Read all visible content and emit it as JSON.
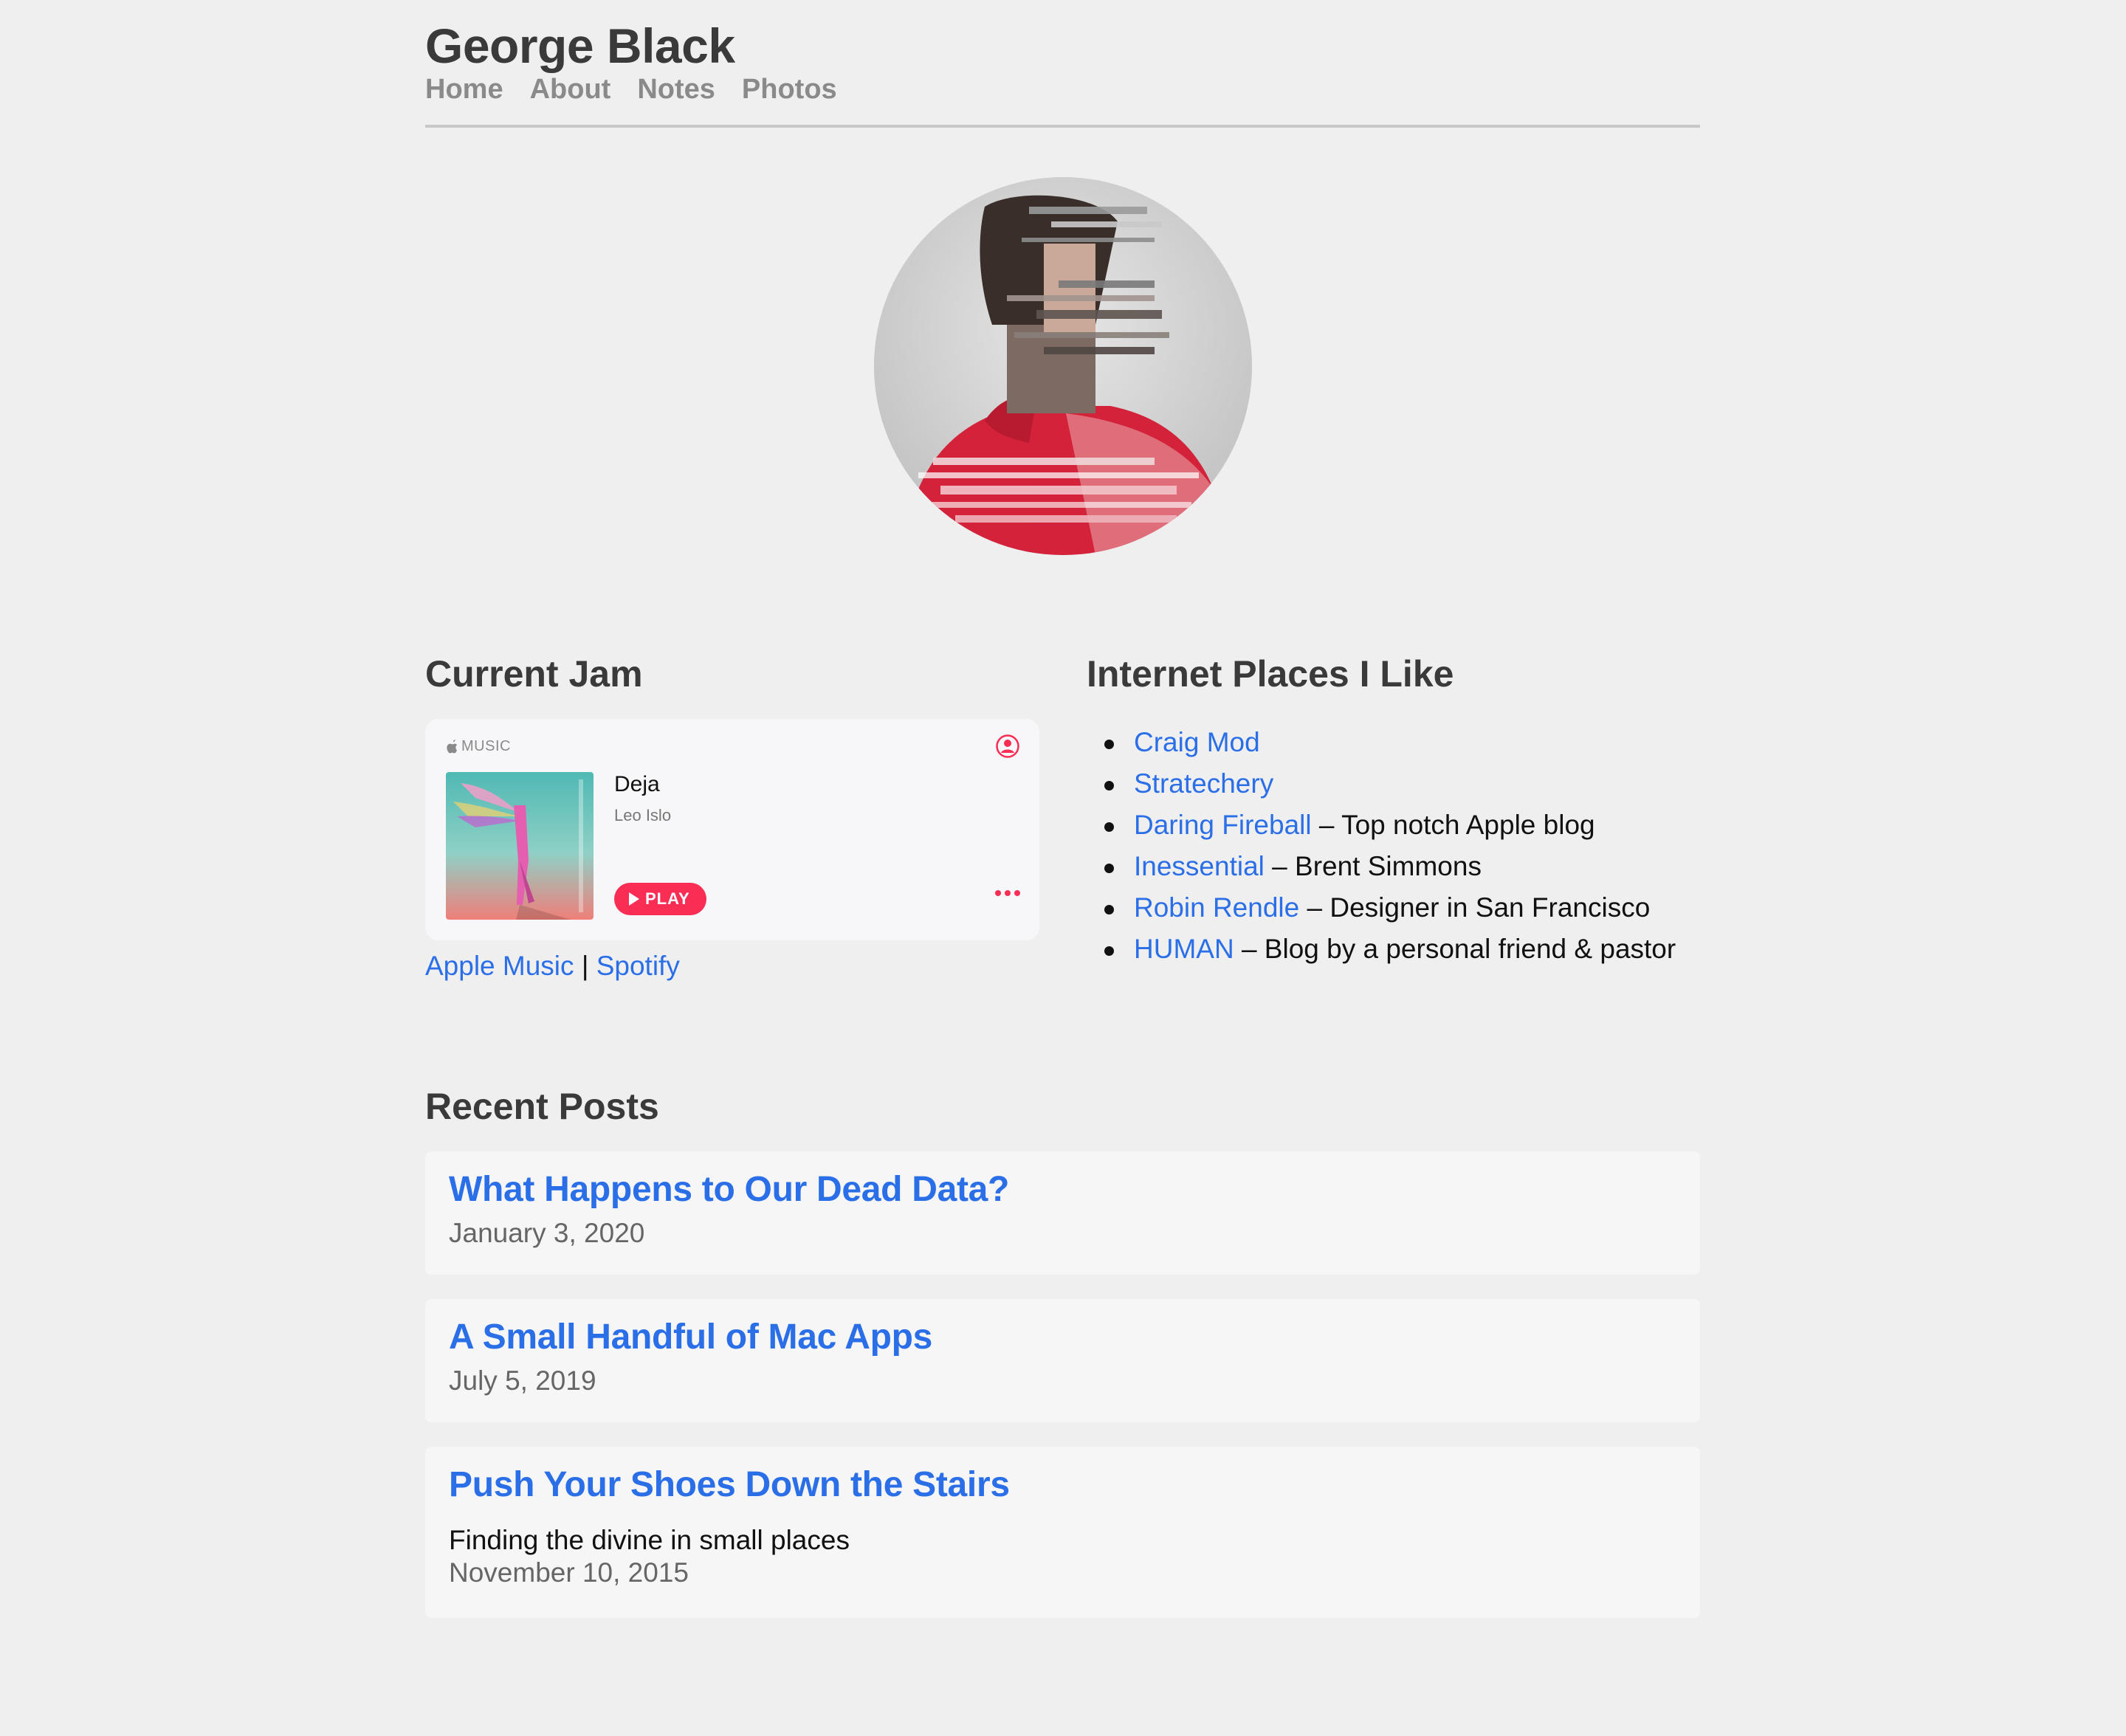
{
  "site": {
    "title": "George Black",
    "nav": [
      "Home",
      "About",
      "Notes",
      "Photos"
    ]
  },
  "current_jam": {
    "heading": "Current Jam",
    "brand": "MUSIC",
    "track_title": "Deja",
    "track_artist": "Leo Islo",
    "play_label": "PLAY",
    "links": {
      "apple_music": "Apple Music",
      "separator": "|",
      "spotify": "Spotify"
    }
  },
  "places": {
    "heading": "Internet Places I Like",
    "items": [
      {
        "name": "Craig Mod",
        "description": ""
      },
      {
        "name": "Stratechery",
        "description": ""
      },
      {
        "name": "Daring Fireball",
        "description": "– Top notch Apple blog"
      },
      {
        "name": "Inessential",
        "description": "– Brent Simmons"
      },
      {
        "name": "Robin Rendle",
        "description": "– Designer in San Francisco"
      },
      {
        "name": "HUMAN",
        "description": "– Blog by a personal friend & pastor"
      }
    ]
  },
  "recent_posts": {
    "heading": "Recent Posts",
    "posts": [
      {
        "title": "What Happens to Our Dead Data?",
        "subtitle": "",
        "date": "January 3, 2020"
      },
      {
        "title": "A Small Handful of Mac Apps",
        "subtitle": "",
        "date": "July 5, 2019"
      },
      {
        "title": "Push Your Shoes Down the Stairs",
        "subtitle": "Finding the divine in small places",
        "date": "November 10, 2015"
      }
    ]
  },
  "colors": {
    "background": "#efefef",
    "link": "#2a6ee8",
    "heading": "#3a3a3a",
    "nav": "#8a8a8a",
    "apple_music_accent": "#fa2d55"
  }
}
